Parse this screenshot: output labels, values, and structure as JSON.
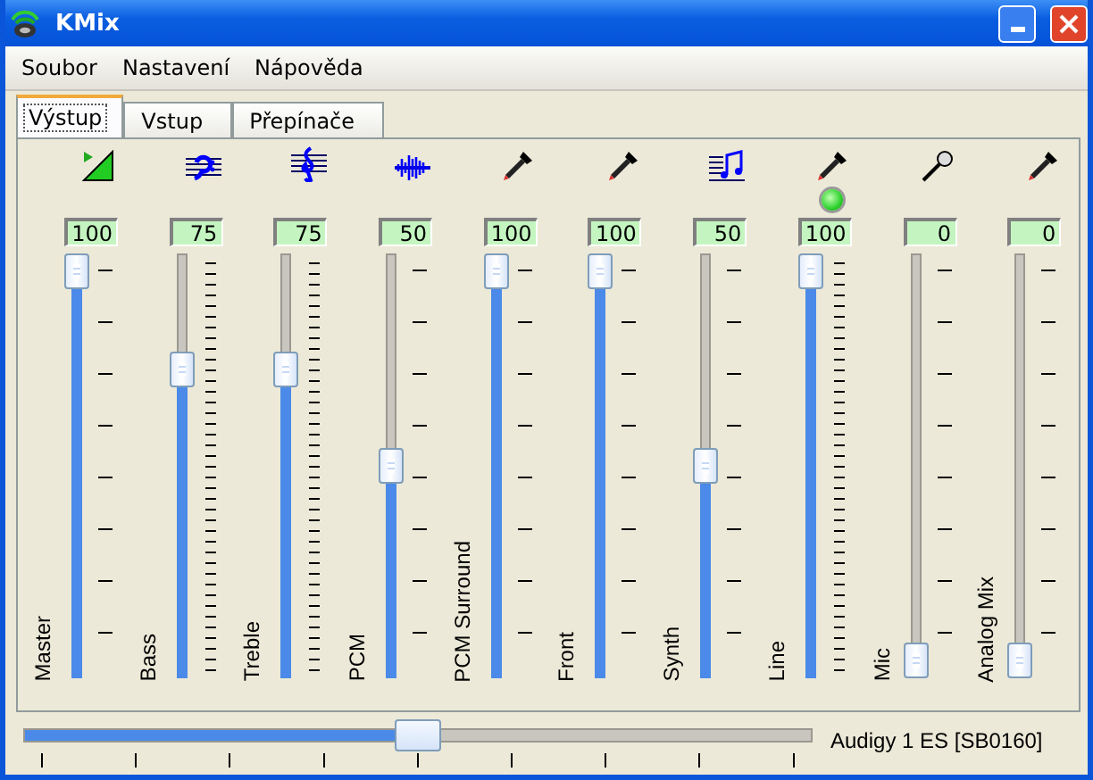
{
  "window": {
    "title": "KMix"
  },
  "menu": [
    "Soubor",
    "Nastavení",
    "Nápověda"
  ],
  "tabs": [
    {
      "label": "Výstup",
      "selected": true
    },
    {
      "label": "Vstup",
      "selected": false
    },
    {
      "label": "Přepínače",
      "selected": false
    }
  ],
  "channels": [
    {
      "name": "Master",
      "kind": "volume",
      "value": "100",
      "level": 1,
      "fine_ticks": false,
      "led": false
    },
    {
      "name": "Bass",
      "kind": "bass",
      "value": "75",
      "level": 0.75,
      "fine_ticks": true,
      "led": false
    },
    {
      "name": "Treble",
      "kind": "treble",
      "value": "75",
      "level": 0.75,
      "fine_ticks": true,
      "led": false
    },
    {
      "name": "PCM",
      "kind": "wave",
      "value": "50",
      "level": 0.5,
      "fine_ticks": false,
      "led": false
    },
    {
      "name": "PCM Surround",
      "kind": "plug",
      "value": "100",
      "level": 1,
      "fine_ticks": false,
      "led": false
    },
    {
      "name": "Front",
      "kind": "plug",
      "value": "100",
      "level": 1,
      "fine_ticks": false,
      "led": false
    },
    {
      "name": "Synth",
      "kind": "notes",
      "value": "50",
      "level": 0.5,
      "fine_ticks": false,
      "led": false
    },
    {
      "name": "Line",
      "kind": "plug",
      "value": "100",
      "level": 1,
      "fine_ticks": true,
      "led": true
    },
    {
      "name": "Mic",
      "kind": "mic",
      "value": "0",
      "level": 0,
      "fine_ticks": false,
      "led": false
    },
    {
      "name": "Analog Mix",
      "kind": "plug",
      "value": "0",
      "level": 0,
      "fine_ticks": false,
      "led": false
    }
  ],
  "balance": {
    "level": 0.5
  },
  "device": "Audigy 1 ES [SB0160]"
}
